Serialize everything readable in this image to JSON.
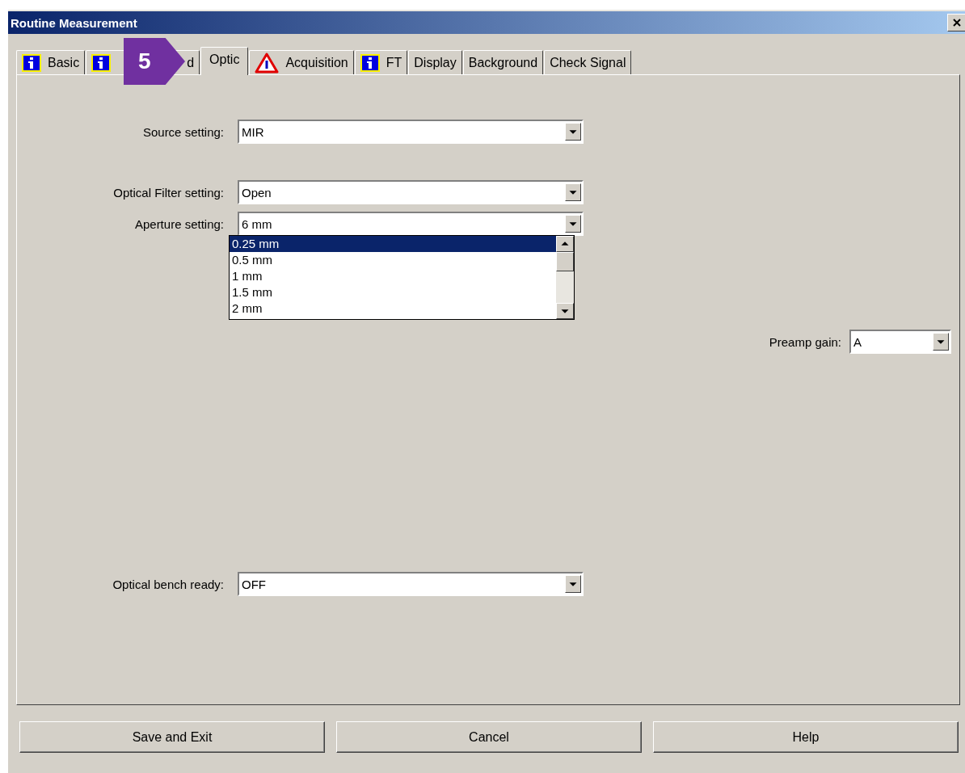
{
  "window": {
    "title": "Routine Measurement"
  },
  "tabs": [
    {
      "label": "Basic",
      "kind": "info",
      "selected": false
    },
    {
      "label": "d",
      "kind": "info",
      "selected": false
    },
    {
      "label": "Optic",
      "kind": "plain",
      "selected": true
    },
    {
      "label": "Acquisition",
      "kind": "warning",
      "selected": false
    },
    {
      "label": "FT",
      "kind": "info",
      "selected": false
    },
    {
      "label": "Display",
      "kind": "plain",
      "selected": false
    },
    {
      "label": "Background",
      "kind": "plain",
      "selected": false
    },
    {
      "label": "Check Signal",
      "kind": "plain",
      "selected": false
    }
  ],
  "callout": {
    "text": "5"
  },
  "fields": [
    {
      "label": "Source setting:",
      "value": "MIR"
    },
    {
      "label": "Optical Filter setting:",
      "value": "Open"
    },
    {
      "label": "Aperture setting:",
      "value": "6 mm",
      "open": true
    },
    {
      "label": "Optical bench ready:",
      "value": "OFF"
    }
  ],
  "aperture_options": [
    {
      "label": "0.25 mm",
      "selected": true
    },
    {
      "label": "0.5 mm",
      "selected": false
    },
    {
      "label": "1 mm",
      "selected": false
    },
    {
      "label": "1.5 mm",
      "selected": false
    },
    {
      "label": "2 mm",
      "selected": false
    }
  ],
  "side_field": {
    "label": "Preamp gain:",
    "value": "A"
  },
  "buttons": [
    "Save and Exit",
    "Cancel",
    "Help"
  ]
}
